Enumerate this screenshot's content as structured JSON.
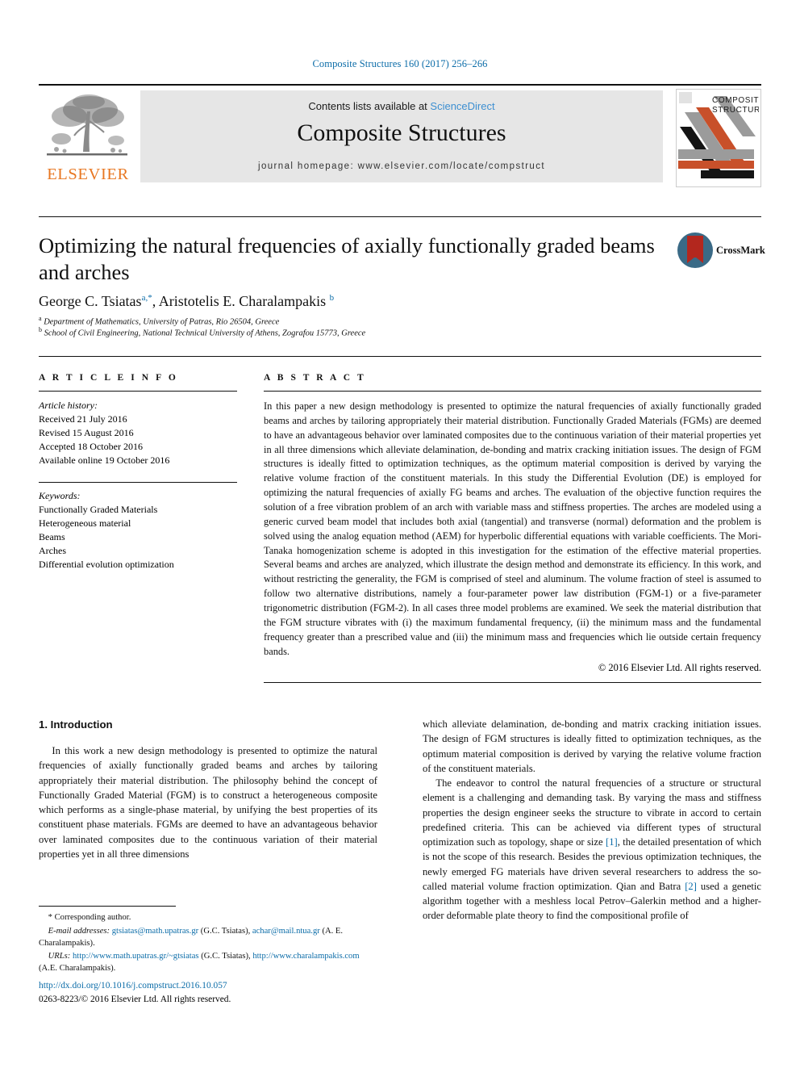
{
  "running_head": "Composite Structures 160 (2017) 256–266",
  "masthead": {
    "publisher_name": "ELSEVIER",
    "contents_prefix": "Contents lists available at ",
    "contents_link": "ScienceDirect",
    "journal_title": "Composite Structures",
    "homepage": "journal homepage: www.elsevier.com/locate/compstruct",
    "cover_title_line1": "COMPOSITE",
    "cover_title_line2": "STRUCTURES"
  },
  "article": {
    "title": "Optimizing the natural frequencies of axially functionally graded beams and arches",
    "crossmark_label": "CrossMark",
    "authors_html": "George C. Tsiatas <sup>a,*</sup>, Aristotelis E. Charalampakis <sup>b</sup>",
    "affiliation_a": "Department of Mathematics, University of Patras, Rio 26504, Greece",
    "affiliation_b": "School of Civil Engineering, National Technical University of Athens, Zografou 15773, Greece"
  },
  "article_info": {
    "heading": "A R T I C L E  I N F O",
    "history_label": "Article history:",
    "history": [
      "Received 21 July 2016",
      "Revised 15 August 2016",
      "Accepted 18 October 2016",
      "Available online 19 October 2016"
    ],
    "keywords_label": "Keywords:",
    "keywords": [
      "Functionally Graded Materials",
      "Heterogeneous material",
      "Beams",
      "Arches",
      "Differential evolution optimization"
    ]
  },
  "abstract": {
    "heading": "A B S T R A C T",
    "text": "In this paper a new design methodology is presented to optimize the natural frequencies of axially functionally graded beams and arches by tailoring appropriately their material distribution. Functionally Graded Materials (FGMs) are deemed to have an advantageous behavior over laminated composites due to the continuous variation of their material properties yet in all three dimensions which alleviate delamination, de-bonding and matrix cracking initiation issues. The design of FGM structures is ideally fitted to optimization techniques, as the optimum material composition is derived by varying the relative volume fraction of the constituent materials. In this study the Differential Evolution (DE) is employed for optimizing the natural frequencies of axially FG beams and arches. The evaluation of the objective function requires the solution of a free vibration problem of an arch with variable mass and stiffness properties. The arches are modeled using a generic curved beam model that includes both axial (tangential) and transverse (normal) deformation and the problem is solved using the analog equation method (AEM) for hyperbolic differential equations with variable coefficients. The Mori-Tanaka homogenization scheme is adopted in this investigation for the estimation of the effective material properties. Several beams and arches are analyzed, which illustrate the design method and demonstrate its efficiency. In this work, and without restricting the generality, the FGM is comprised of steel and aluminum. The volume fraction of steel is assumed to follow two alternative distributions, namely a four-parameter power law distribution (FGM-1) or a five-parameter trigonometric distribution (FGM-2). In all cases three model problems are examined. We seek the material distribution that the FGM structure vibrates with (i) the maximum fundamental frequency, (ii) the minimum mass and the fundamental frequency greater than a prescribed value and (iii) the minimum mass and frequencies which lie outside certain frequency bands.",
    "copyright": "© 2016 Elsevier Ltd. All rights reserved."
  },
  "introduction": {
    "section_title": "1. Introduction",
    "left_para_1": "In this work a new design methodology is presented to optimize the natural frequencies of axially functionally graded beams and arches by tailoring appropriately their material distribution. The philosophy behind the concept of Functionally Graded Material (FGM) is to construct a heterogeneous composite which performs as a single-phase material, by unifying the best properties of its constituent phase materials. FGMs are deemed to have an advantageous behavior over laminated composites due to the continuous variation of their material properties yet in all three dimensions",
    "right_para_1": "which alleviate delamination, de-bonding and matrix cracking initiation issues. The design of FGM structures is ideally fitted to optimization techniques, as the optimum material composition is derived by varying the relative volume fraction of the constituent materials.",
    "right_para_2_before": "The endeavor to control the natural frequencies of a structure or structural element is a challenging and demanding task. By varying the mass and stiffness properties the design engineer seeks the structure to vibrate in accord to certain predefined criteria. This can be achieved via different types of structural optimization such as topology, shape or size ",
    "right_ref_1": "[1]",
    "right_para_2_middle": ", the detailed presentation of which is not the scope of this research. Besides the previous optimization techniques, the newly emerged FG materials have driven several researchers to address the so-called material volume fraction optimization. Qian and Batra ",
    "right_ref_2": "[2]",
    "right_para_2_after": " used a genetic algorithm together with a meshless local Petrov–Galerkin method and a higher-order deformable plate theory to find the compositional profile of"
  },
  "footnotes": {
    "corresponding": "* Corresponding author.",
    "email_label": "E-mail addresses:",
    "email_1": "gtsiatas@math.upatras.gr",
    "email_1_who": " (G.C. Tsiatas), ",
    "email_2": "achar@mail.ntua.gr",
    "email_2_who": " (A. E. Charalampakis).",
    "urls_label": "URLs:",
    "url_1": "http://www.math.upatras.gr/~gtsiatas",
    "url_1_who": " (G.C. Tsiatas), ",
    "url_2": "http://www.charalampakis.com",
    "url_2_who": " (A.E. Charalampakis)."
  },
  "doi_block": {
    "doi": "http://dx.doi.org/10.1016/j.compstruct.2016.10.057",
    "issn_copyright": "0263-8223/© 2016 Elsevier Ltd. All rights reserved."
  },
  "colors": {
    "link_blue": "#0b6ca8",
    "sciencedirect_blue": "#3d8fd1",
    "elsevier_orange": "#E87722",
    "banner_gray": "#e6e6e6",
    "cover_orange": "#c8502a",
    "cover_gray": "#9b9b9b",
    "cover_black": "#141414"
  }
}
